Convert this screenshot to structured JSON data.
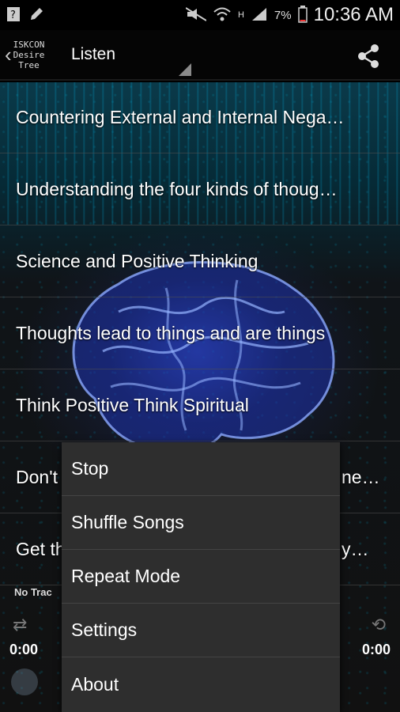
{
  "statusbar": {
    "battery": "7%",
    "time": "10:36 AM",
    "icons": [
      "unknown-app-icon",
      "pen-icon",
      "mute-icon",
      "wifi-icon",
      "h-signal-icon",
      "signal-icon",
      "battery-icon"
    ]
  },
  "actionbar": {
    "logo_lines": [
      "ISKCON",
      "Desire",
      "Tree"
    ],
    "title": "Listen"
  },
  "tracks": [
    "Countering External and Internal Nega…",
    "Understanding the four kinds of thoug…",
    "Science and Positive Thinking",
    "Thoughts lead to things and are things",
    "Think Positive Think Spiritual",
    "Don't",
    "Get th"
  ],
  "track_suffix": {
    "row5": "ne…",
    "row6": "y…"
  },
  "player": {
    "now_playing": "No Trac",
    "time_left": "0:00",
    "time_right": "0:00"
  },
  "menu": {
    "items": [
      "Stop",
      "Shuffle Songs",
      "Repeat Mode",
      "Settings",
      "About"
    ]
  }
}
